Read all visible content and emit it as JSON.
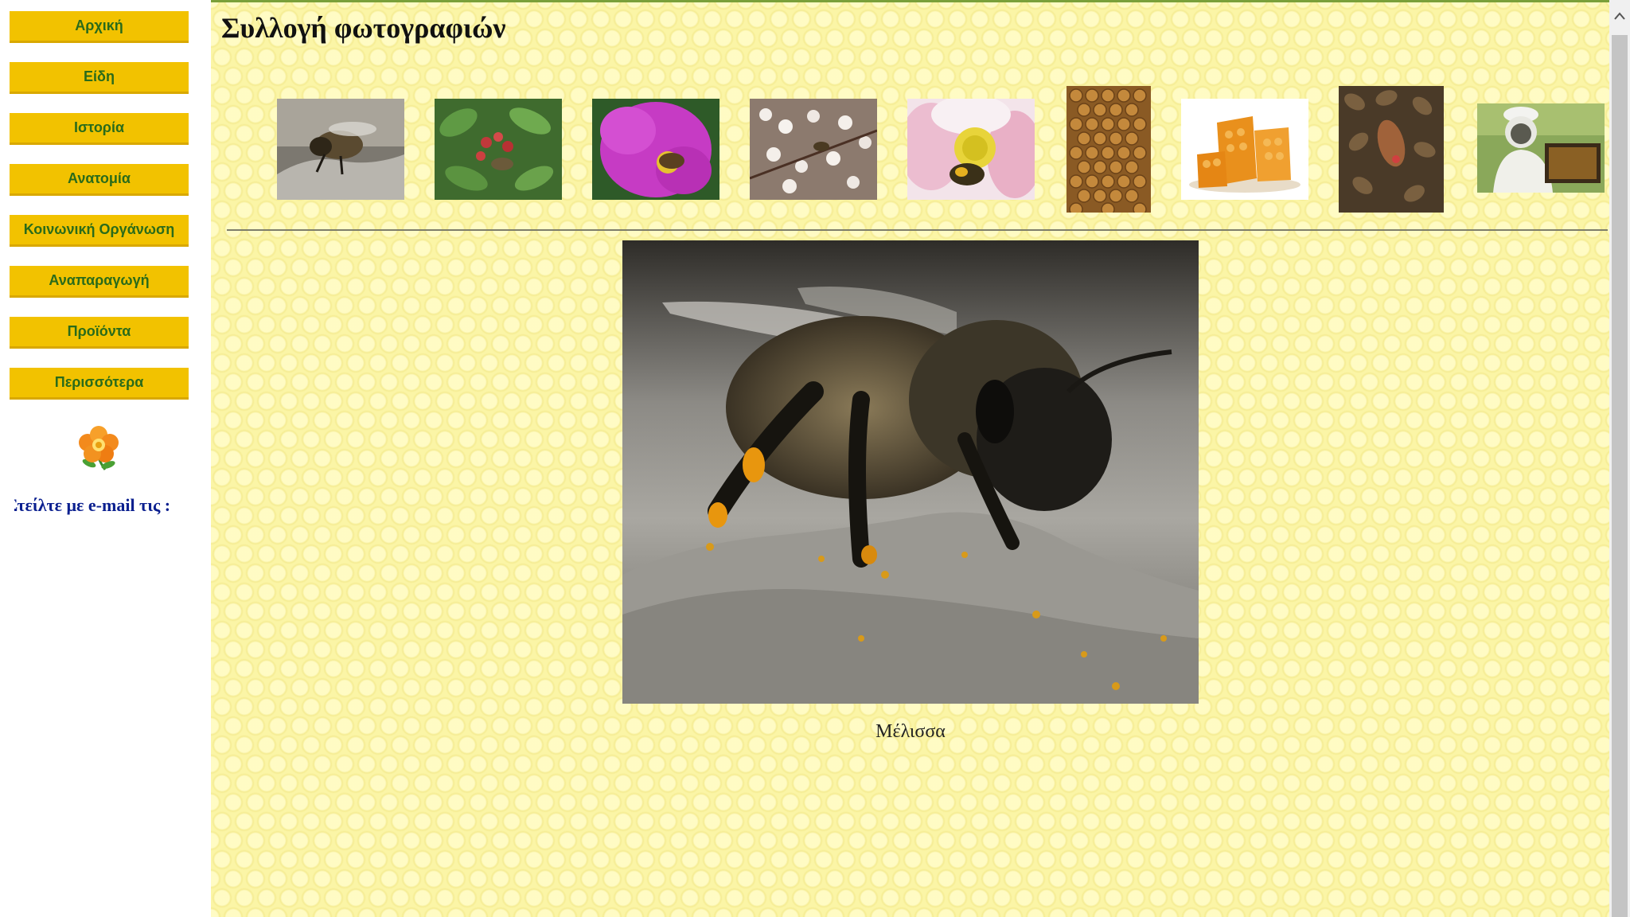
{
  "sidebar": {
    "items": [
      {
        "label": "Αρχική"
      },
      {
        "label": "Είδη"
      },
      {
        "label": "Ιστορία"
      },
      {
        "label": "Ανατομία"
      },
      {
        "label": "Κοινωνική Οργάνωση"
      },
      {
        "label": "Αναπαραγωγή"
      },
      {
        "label": "Προϊόντα"
      },
      {
        "label": "Περισσότερα"
      }
    ],
    "flower_icon": "flower-icon",
    "mail_link": "Στείλτε με e-mail τις :"
  },
  "main": {
    "title": "Συλλογή φωτογραφιών",
    "thumbnails": [
      {
        "icon": "bee-on-rock-thumbnail"
      },
      {
        "icon": "bee-on-red-berries-thumbnail"
      },
      {
        "icon": "bee-on-purple-flower-thumbnail"
      },
      {
        "icon": "bee-on-white-blossoms-thumbnail"
      },
      {
        "icon": "bee-in-pink-flower-thumbnail"
      },
      {
        "icon": "honeycomb-cells-thumbnail"
      },
      {
        "icon": "honeycomb-pieces-thumbnail"
      },
      {
        "icon": "bees-on-comb-thumbnail"
      },
      {
        "icon": "beekeeper-thumbnail"
      }
    ],
    "selected_photo": {
      "icon": "bee-on-rock-photo",
      "caption": "Μέλισσα"
    }
  },
  "colors": {
    "nav_button": "#f2c200",
    "nav_text": "#2a6b1a",
    "background": "#fbf5a6",
    "link": "#0a1f8f"
  },
  "scrollbar": {
    "up_icon": "chevron-up-icon"
  }
}
